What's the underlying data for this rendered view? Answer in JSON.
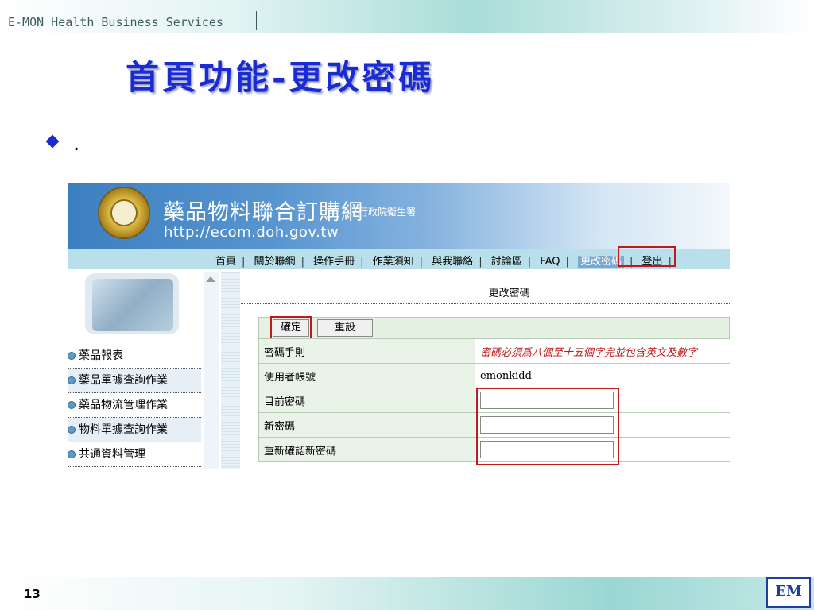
{
  "slide": {
    "brand": "E-MON Health Business Services",
    "title": "首頁功能-更改密碼",
    "bullet": ".",
    "page_number": "13",
    "logo": "EM"
  },
  "site": {
    "name": "藥品物料聯合訂購網",
    "org": "行政院衛生署",
    "url": "http://ecom.doh.gov.tw",
    "nav": [
      "首頁",
      "關於聯網",
      "操作手冊",
      "作業須知",
      "與我聯絡",
      "討論區",
      "FAQ",
      "更改密碼",
      "登出"
    ],
    "nav_active": "更改密碼",
    "sidebar": [
      "藥品報表",
      "藥品單據查詢作業",
      "藥品物流管理作業",
      "物料單據查詢作業",
      "共通資料管理"
    ]
  },
  "form": {
    "title": "更改密碼",
    "confirm_label": "確定",
    "reset_label": "重設",
    "rows": [
      {
        "label": "密碼手則",
        "value": "密碼必須爲八個至十五個字完並包含英文及數字"
      },
      {
        "label": "使用者帳號",
        "value": "emonkidd"
      },
      {
        "label": "目前密碼",
        "value": ""
      },
      {
        "label": "新密碼",
        "value": ""
      },
      {
        "label": "重新確認新密碼",
        "value": ""
      }
    ]
  },
  "colors": {
    "title": "#1a2bd4",
    "highlight": "#c0191c",
    "rule_text": "#c01818"
  }
}
